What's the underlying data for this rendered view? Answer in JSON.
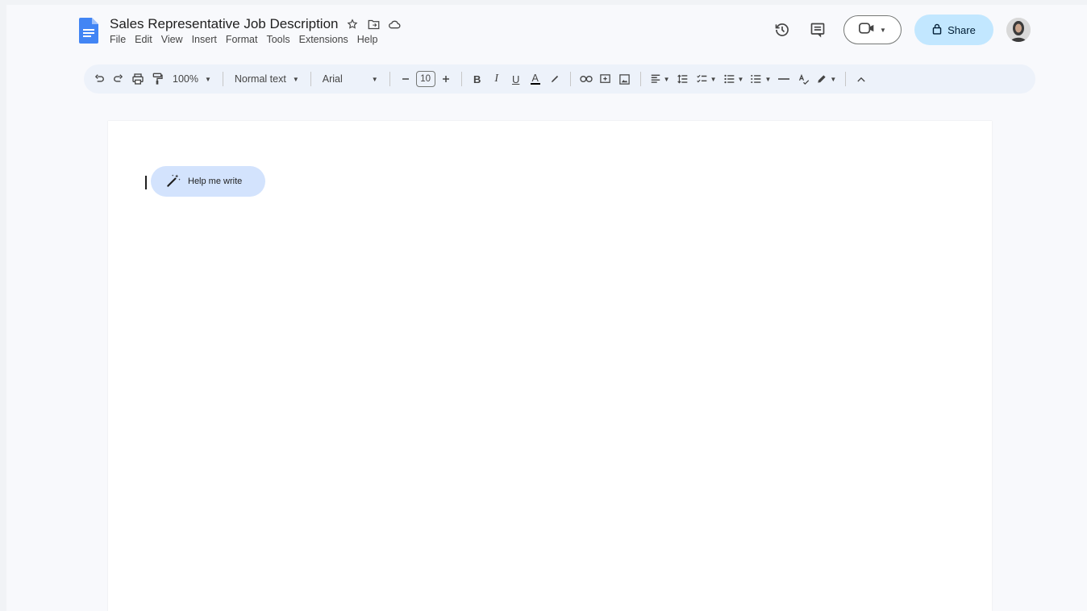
{
  "document": {
    "title": "Sales Representative Job Description"
  },
  "menu": [
    "File",
    "Edit",
    "View",
    "Insert",
    "Format",
    "Tools",
    "Extensions",
    "Help"
  ],
  "header": {
    "share_label": "Share"
  },
  "toolbar": {
    "zoom": "100%",
    "style": "Normal text",
    "font": "Arial",
    "font_size": "10",
    "bold": "B",
    "italic": "I",
    "underline": "U",
    "text_color": "A"
  },
  "editor": {
    "help_me_write": "Help me write"
  },
  "colors": {
    "brand_blue": "#4285f4",
    "share_bg": "#c2e7ff",
    "toolbar_bg": "#edf2fa",
    "help_chip_bg": "#d3e3fd"
  }
}
